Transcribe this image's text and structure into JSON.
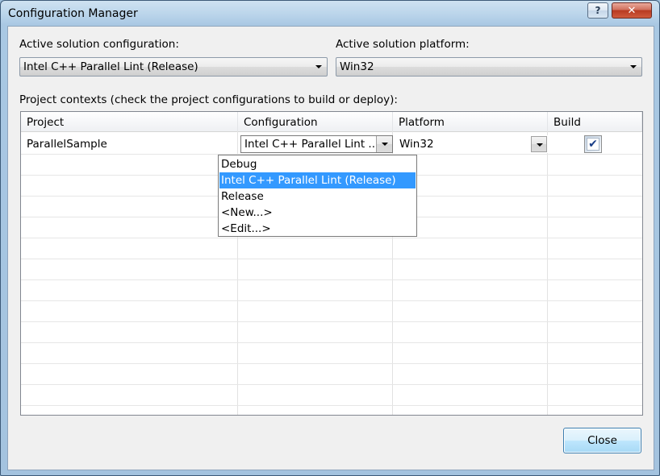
{
  "window": {
    "title": "Configuration Manager",
    "help_label": "?",
    "close_label": "✕"
  },
  "active_config": {
    "label": "Active solution configuration:",
    "value": "Intel C++ Parallel Lint (Release)"
  },
  "active_platform": {
    "label": "Active solution platform:",
    "value": "Win32"
  },
  "contexts_label": "Project contexts (check the project configurations to build or deploy):",
  "table": {
    "columns": [
      "Project",
      "Configuration",
      "Platform",
      "Build"
    ],
    "rows": [
      {
        "project": "ParallelSample",
        "configuration": "Intel C++ Parallel Lint ...",
        "platform": "Win32",
        "build": true
      }
    ]
  },
  "config_dropdown": {
    "options": [
      "Debug",
      "Intel C++ Parallel Lint (Release)",
      "Release",
      "<New...>",
      "<Edit...>"
    ],
    "selected_index": 1
  },
  "footer": {
    "close_button": "Close"
  },
  "colors": {
    "selection": "#3399ff",
    "title_close": "#c0452c",
    "checkmark": "#1b3f88"
  }
}
